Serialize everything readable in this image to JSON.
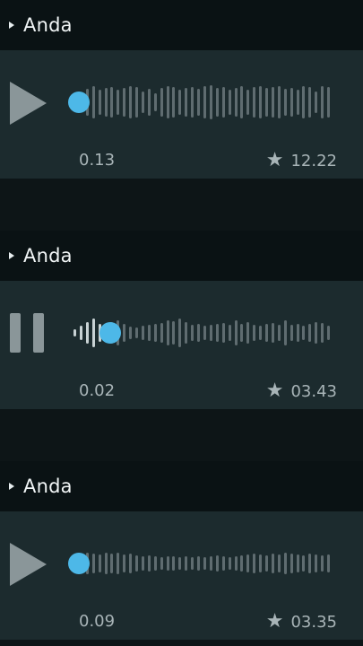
{
  "messages": [
    {
      "sender": "Anda",
      "state": "paused",
      "control_icon": "play-icon",
      "elapsed": "0.13",
      "duration": "12.22",
      "progress": 0.0,
      "bar_heights": [
        0.35,
        0.55,
        0.75,
        0.9,
        0.7,
        0.8,
        0.85,
        0.7,
        0.8,
        0.9,
        0.85,
        0.6,
        0.75,
        0.5,
        0.8,
        0.9,
        0.85,
        0.7,
        0.8,
        0.85,
        0.75,
        0.9,
        0.95,
        0.8,
        0.85,
        0.7,
        0.8,
        0.9,
        0.7,
        0.85,
        0.9,
        0.8,
        0.85,
        0.9,
        0.75,
        0.8,
        0.7,
        0.9,
        0.85,
        0.6,
        0.9,
        0.85
      ]
    },
    {
      "sender": "Anda",
      "state": "playing",
      "control_icon": "pause-icon",
      "elapsed": "0.02",
      "duration": "03.43",
      "progress": 0.12,
      "bar_heights": [
        0.2,
        0.4,
        0.6,
        0.8,
        0.5,
        0.3,
        0.6,
        0.7,
        0.5,
        0.35,
        0.3,
        0.4,
        0.45,
        0.5,
        0.55,
        0.7,
        0.65,
        0.8,
        0.6,
        0.45,
        0.5,
        0.4,
        0.45,
        0.5,
        0.55,
        0.45,
        0.7,
        0.5,
        0.6,
        0.45,
        0.4,
        0.5,
        0.55,
        0.45,
        0.7,
        0.45,
        0.5,
        0.4,
        0.5,
        0.6,
        0.55,
        0.4
      ]
    },
    {
      "sender": "Anda",
      "state": "paused",
      "control_icon": "play-icon",
      "elapsed": "0.09",
      "duration": "03.35",
      "progress": 0.0,
      "bar_heights": [
        0.3,
        0.5,
        0.6,
        0.55,
        0.5,
        0.6,
        0.55,
        0.6,
        0.5,
        0.55,
        0.45,
        0.4,
        0.45,
        0.4,
        0.35,
        0.4,
        0.4,
        0.35,
        0.4,
        0.35,
        0.4,
        0.35,
        0.4,
        0.45,
        0.4,
        0.35,
        0.4,
        0.45,
        0.5,
        0.55,
        0.5,
        0.45,
        0.55,
        0.5,
        0.6,
        0.55,
        0.5,
        0.45,
        0.55,
        0.5,
        0.45,
        0.5
      ]
    }
  ],
  "colors": {
    "accent": "#4db8e8",
    "card": "#1c2b2e",
    "header": "#0a1214",
    "text_muted": "#a8b4b7"
  }
}
